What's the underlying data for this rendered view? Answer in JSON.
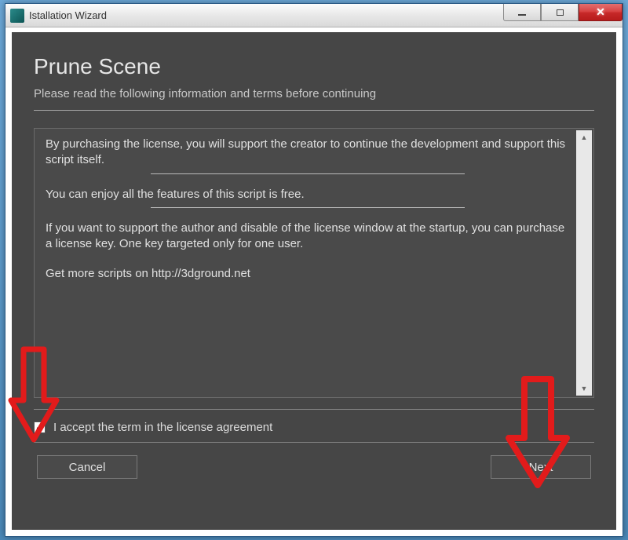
{
  "window": {
    "title": "Istallation Wizard"
  },
  "page": {
    "heading": "Prune Scene",
    "subheading": "Please read the following information and terms before continuing"
  },
  "license": {
    "p1": "By purchasing the license, you will support the creator  to continue the development and support this script itself.",
    "p2": "You can enjoy all the features of this script is free.",
    "p3": "If you want to support the author and disable of the license window at the startup, you can purchase a license key. One key targeted only for one user.",
    "p4": "Get more scripts on http://3dground.net"
  },
  "accept": {
    "checked": true,
    "label": "I accept the term in the license agreement"
  },
  "buttons": {
    "cancel": "Cancel",
    "next": "Next"
  }
}
